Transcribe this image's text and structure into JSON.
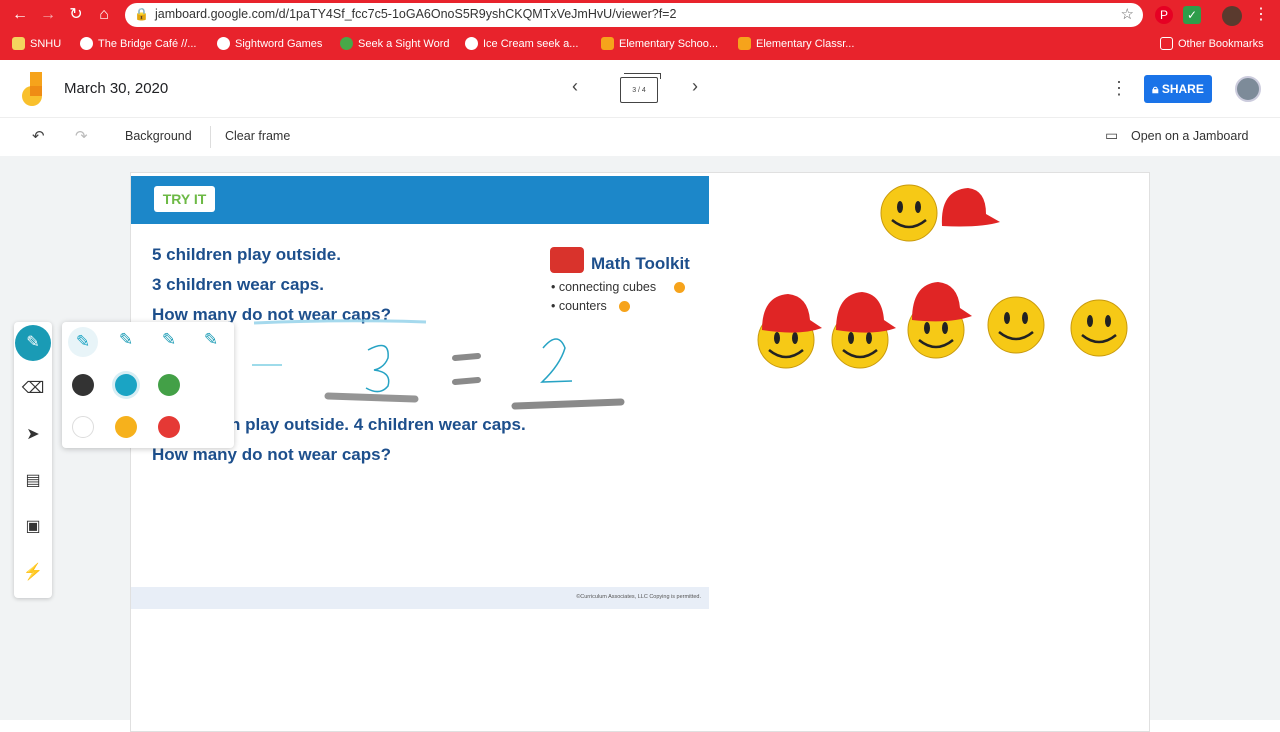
{
  "browser": {
    "url": "jamboard.google.com/d/1paTY4Sf_fcc7c5-1oGA6OnoS5R9yshCKQMTxVeJmHvU/viewer?f=2",
    "bookmarks": [
      {
        "label": "SNHU",
        "color": "#f4d35e"
      },
      {
        "label": "The Bridge Café //...",
        "color": "#ffffff"
      },
      {
        "label": "Sightword Games",
        "color": "#ffffff"
      },
      {
        "label": "Seek a Sight Word",
        "color": "#48a848"
      },
      {
        "label": "Ice Cream seek a...",
        "color": "#ffffff"
      },
      {
        "label": "Elementary Schoo...",
        "color": "#f6a31b"
      },
      {
        "label": "Elementary Classr...",
        "color": "#f6a31b"
      }
    ],
    "other_bookmarks": "Other Bookmarks"
  },
  "header": {
    "title": "March 30, 2020",
    "frame_counter": "3 / 4",
    "share_label": "SHARE"
  },
  "toolbar": {
    "background_label": "Background",
    "clear_label": "Clear frame",
    "open_jamboard_label": "Open on a Jamboard"
  },
  "worksheet": {
    "badge": "TRY IT",
    "line1": "5 children play outside.",
    "line2": "3 children wear caps.",
    "line3": "How many do not wear caps?",
    "line4": "n play outside. 4 children wear caps.",
    "line5": "How many do not wear caps?",
    "toolkit_title": "Math Toolkit",
    "toolkit_items": [
      "• connecting cubes",
      "• counters"
    ],
    "footer": "©Curriculum Associates, LLC   Copying is permitted.",
    "handwritten": [
      "3",
      "=",
      "2"
    ]
  },
  "pen_colors": [
    "#333333",
    "#1aa4c4",
    "#43a047",
    "#ffffff",
    "#f6b11c",
    "#e53935"
  ],
  "accent": "#1a73e8"
}
